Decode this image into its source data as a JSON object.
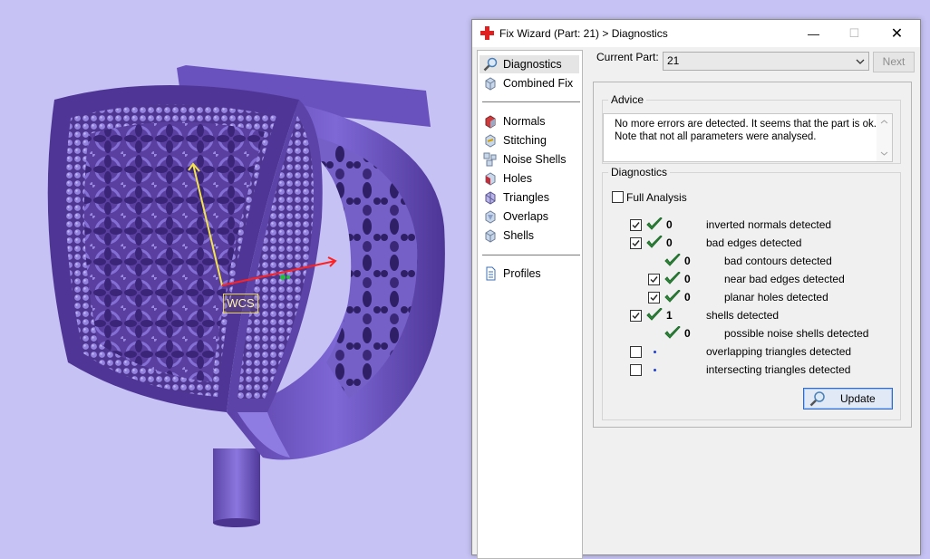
{
  "viewport": {
    "wcs_label": "WCS",
    "background_color": "#c6c2f4",
    "model_color": "#6a4fb3"
  },
  "dialog": {
    "title": "Fix Wizard (Part: 21) > Diagnostics",
    "minimize_glyph": "—",
    "maximize_glyph": "☐",
    "close_glyph": "✕",
    "nav": {
      "items_top": [
        {
          "label": "Diagnostics",
          "icon": "magnifier-icon",
          "selected": true
        },
        {
          "label": "Combined Fix",
          "icon": "cube-icon",
          "selected": false
        }
      ],
      "items_fix": [
        {
          "label": "Normals",
          "icon": "normals-cube-icon"
        },
        {
          "label": "Stitching",
          "icon": "stitching-icon"
        },
        {
          "label": "Noise Shells",
          "icon": "noise-shells-icon"
        },
        {
          "label": "Holes",
          "icon": "holes-icon"
        },
        {
          "label": "Triangles",
          "icon": "triangles-icon"
        },
        {
          "label": "Overlaps",
          "icon": "overlaps-icon"
        },
        {
          "label": "Shells",
          "icon": "shells-icon"
        }
      ],
      "items_bottom": [
        {
          "label": "Profiles",
          "icon": "document-icon"
        }
      ]
    },
    "current_part_label": "Current Part:",
    "current_part_value": "21",
    "next_label": "Next",
    "advice": {
      "legend": "Advice",
      "text": "No more errors are detected. It seems that the part is ok. Note that not all parameters were analysed."
    },
    "diagnostics": {
      "legend": "Diagnostics",
      "full_analysis_label": "Full Analysis",
      "full_analysis_checked": false,
      "rows": [
        {
          "checked": true,
          "has_checkbox": true,
          "status": "ok",
          "count": "0",
          "label": "inverted normals detected",
          "indent": 0
        },
        {
          "checked": true,
          "has_checkbox": true,
          "status": "ok",
          "count": "0",
          "label": "bad edges detected",
          "indent": 0
        },
        {
          "checked": false,
          "has_checkbox": false,
          "status": "ok",
          "count": "0",
          "label": "bad contours detected",
          "indent": 1
        },
        {
          "checked": true,
          "has_checkbox": true,
          "status": "ok",
          "count": "0",
          "label": "near bad edges detected",
          "indent": 1
        },
        {
          "checked": true,
          "has_checkbox": true,
          "status": "ok",
          "count": "0",
          "label": "planar holes detected",
          "indent": 1
        },
        {
          "checked": true,
          "has_checkbox": true,
          "status": "ok",
          "count": "1",
          "label": "shells detected",
          "indent": 0
        },
        {
          "checked": false,
          "has_checkbox": false,
          "status": "ok",
          "count": "0",
          "label": "possible noise shells detected",
          "indent": 1
        },
        {
          "checked": false,
          "has_checkbox": true,
          "status": "none",
          "count": "",
          "label": "overlapping triangles detected",
          "indent": 0
        },
        {
          "checked": false,
          "has_checkbox": true,
          "status": "none",
          "count": "",
          "label": "intersecting triangles detected",
          "indent": 0
        }
      ],
      "update_label": "Update"
    }
  }
}
